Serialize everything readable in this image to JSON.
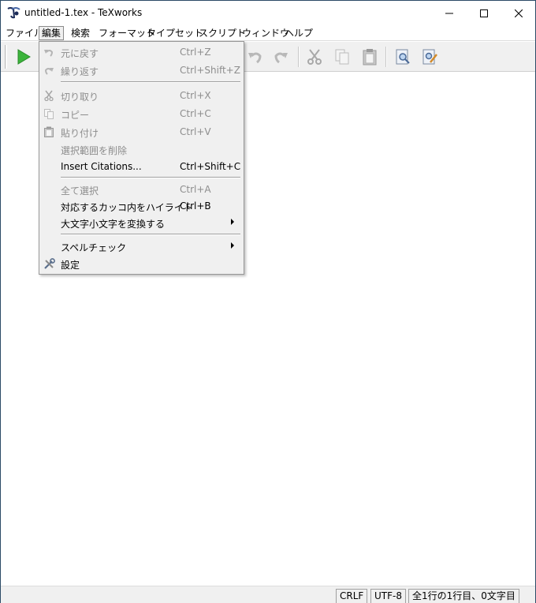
{
  "window": {
    "title": "untitled-1.tex - TeXworks"
  },
  "menubar": {
    "items": [
      {
        "label": "ファイル"
      },
      {
        "label": "編集"
      },
      {
        "label": "検索"
      },
      {
        "label": "フォーマット"
      },
      {
        "label": "タイプセット"
      },
      {
        "label": "スクリプト"
      },
      {
        "label": "ウィンドウ"
      },
      {
        "label": "ヘルプ"
      }
    ]
  },
  "edit_menu": {
    "items": [
      {
        "label": "元に戻す",
        "shortcut": "Ctrl+Z",
        "icon": "undo-icon",
        "enabled": false
      },
      {
        "label": "繰り返す",
        "shortcut": "Ctrl+Shift+Z",
        "icon": "redo-icon",
        "enabled": false
      },
      {
        "label": "切り取り",
        "shortcut": "Ctrl+X",
        "icon": "cut-icon",
        "enabled": false
      },
      {
        "label": "コピー",
        "shortcut": "Ctrl+C",
        "icon": "copy-icon",
        "enabled": false
      },
      {
        "label": "貼り付け",
        "shortcut": "Ctrl+V",
        "icon": "paste-icon",
        "enabled": false
      },
      {
        "label": "選択範囲を削除",
        "shortcut": "",
        "icon": "",
        "enabled": false
      },
      {
        "label": "Insert Citations...",
        "shortcut": "Ctrl+Shift+C",
        "icon": "",
        "enabled": true
      },
      {
        "label": "全て選択",
        "shortcut": "Ctrl+A",
        "icon": "",
        "enabled": false
      },
      {
        "label": "対応するカッコ内をハイライト",
        "shortcut": "Ctrl+B",
        "icon": "",
        "enabled": true
      },
      {
        "label": "大文字小文字を変換する",
        "shortcut": "",
        "icon": "",
        "enabled": true,
        "submenu": true
      },
      {
        "label": "スペルチェック",
        "shortcut": "",
        "icon": "",
        "enabled": true,
        "submenu": true
      },
      {
        "label": "設定",
        "shortcut": "",
        "icon": "settings-icon",
        "enabled": true
      }
    ]
  },
  "statusbar": {
    "line_ending": "CRLF",
    "encoding": "UTF-8",
    "position": "全1行の1行目、0文字目"
  },
  "colors": {
    "typeset_green": "#3cb43c",
    "frame_border": "#2b4a66"
  }
}
